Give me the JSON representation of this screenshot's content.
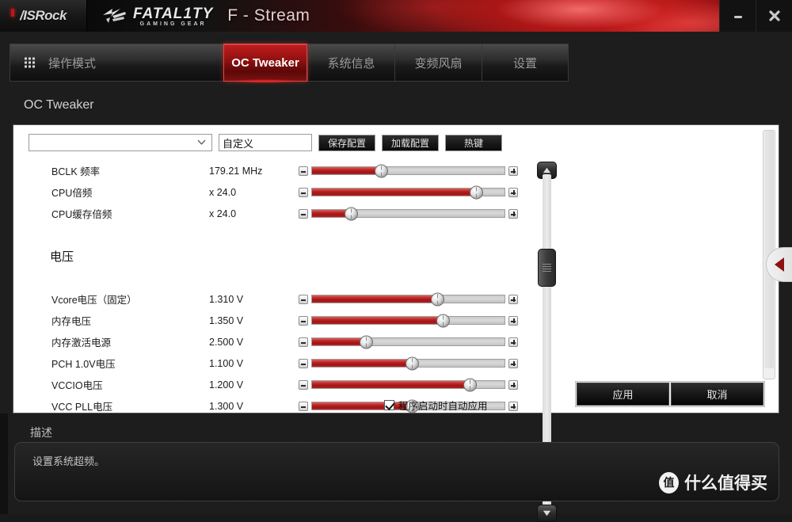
{
  "window": {
    "brand": "/ISRock",
    "logo_main": "FATAL1TY",
    "logo_sub": "GAMING GEAR",
    "product": "F - Stream",
    "minimize_label": "minimize",
    "close_label": "close"
  },
  "tabs": [
    {
      "label": "操作模式",
      "icon": "grid-icon",
      "active": false
    },
    {
      "label": "OC Tweaker",
      "active": true
    },
    {
      "label": "系统信息",
      "active": false
    },
    {
      "label": "变频风扇",
      "active": false
    },
    {
      "label": "设置",
      "active": false
    }
  ],
  "page": {
    "title": "OC Tweaker"
  },
  "toolbar": {
    "profile_select_value": "",
    "profile_select_placeholder": "",
    "profile_name_value": "自定义",
    "save_label": "保存配置",
    "load_label": "加载配置",
    "hotkey_label": "热键"
  },
  "settings": {
    "sections": [
      {
        "heading": "",
        "rows": [
          {
            "label": "BCLK 频率",
            "value": "179.21 MHz",
            "fill": 36
          },
          {
            "label": "CPU倍频",
            "value": "x 24.0",
            "fill": 85
          },
          {
            "label": "CPU缓存倍频",
            "value": "x 24.0",
            "fill": 20
          }
        ]
      },
      {
        "heading": "电压",
        "rows": [
          {
            "label": "Vcore电压（固定）",
            "value": "1.310 V",
            "fill": 65
          },
          {
            "label": "内存电压",
            "value": "1.350 V",
            "fill": 68
          },
          {
            "label": "内存激活电源",
            "value": "2.500 V",
            "fill": 28
          },
          {
            "label": "PCH 1.0V电压",
            "value": "1.100 V",
            "fill": 52
          },
          {
            "label": "VCCIO电压",
            "value": "1.200 V",
            "fill": 82
          },
          {
            "label": "VCC PLL电压",
            "value": "1.300 V",
            "fill": 52
          }
        ]
      }
    ],
    "minus_icon": "minus-icon",
    "plus_icon": "plus-icon"
  },
  "autoapply": {
    "label": "程序启动时自动应用",
    "checked": true
  },
  "actions": {
    "apply_label": "应用",
    "cancel_label": "取消"
  },
  "sidetab": {
    "icon": "triangle-left-icon"
  },
  "description": {
    "title": "描述",
    "text": "设置系统超频。"
  },
  "watermark": {
    "badge": "值",
    "text": "什么值得买"
  },
  "colors": {
    "accent_red": "#b01c1c",
    "slider_red": "#9e1414",
    "panel_bg": "#ffffff",
    "app_bg": "#1d1d1d"
  }
}
